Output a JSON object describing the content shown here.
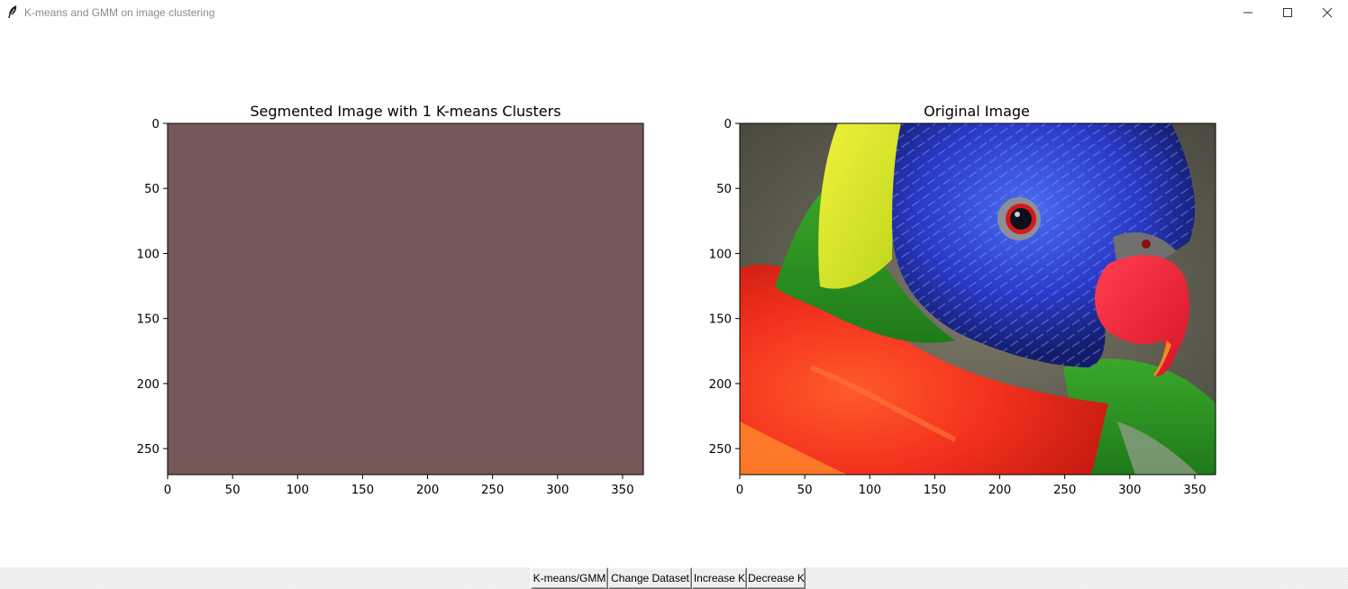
{
  "window": {
    "title": "K-means and GMM on image clustering",
    "icon": "feather-icon",
    "controls": [
      "minimize-icon",
      "maximize-icon",
      "close-icon"
    ]
  },
  "left_plot": {
    "title": "Segmented Image with 1 K-means Clusters",
    "fill_color": "#765858",
    "x_ticks": [
      "0",
      "50",
      "100",
      "150",
      "200",
      "250",
      "300",
      "350"
    ],
    "y_ticks": [
      "0",
      "50",
      "100",
      "150",
      "200",
      "250"
    ]
  },
  "right_plot": {
    "title": "Original Image",
    "x_ticks": [
      "0",
      "50",
      "100",
      "150",
      "200",
      "250",
      "300",
      "350"
    ],
    "y_ticks": [
      "0",
      "50",
      "100",
      "150",
      "200",
      "250"
    ],
    "image_subject": "rainbow lorikeet parrot"
  },
  "toolbar": {
    "buttons": [
      "K-means/GMM",
      "Change Dataset",
      "Increase K",
      "Decrease K"
    ]
  },
  "chart_data": [
    {
      "type": "image",
      "title": "Segmented Image with 1 K-means Clusters",
      "xlim": [
        0,
        366
      ],
      "ylim": [
        270,
        0
      ],
      "x_ticks": [
        0,
        50,
        100,
        150,
        200,
        250,
        300,
        350
      ],
      "y_ticks": [
        0,
        50,
        100,
        150,
        200,
        250
      ],
      "uniform_color": "#765858"
    },
    {
      "type": "image",
      "title": "Original Image",
      "xlim": [
        0,
        366
      ],
      "ylim": [
        270,
        0
      ],
      "x_ticks": [
        0,
        50,
        100,
        150,
        200,
        250,
        300,
        350
      ],
      "y_ticks": [
        0,
        50,
        100,
        150,
        200,
        250
      ]
    }
  ]
}
